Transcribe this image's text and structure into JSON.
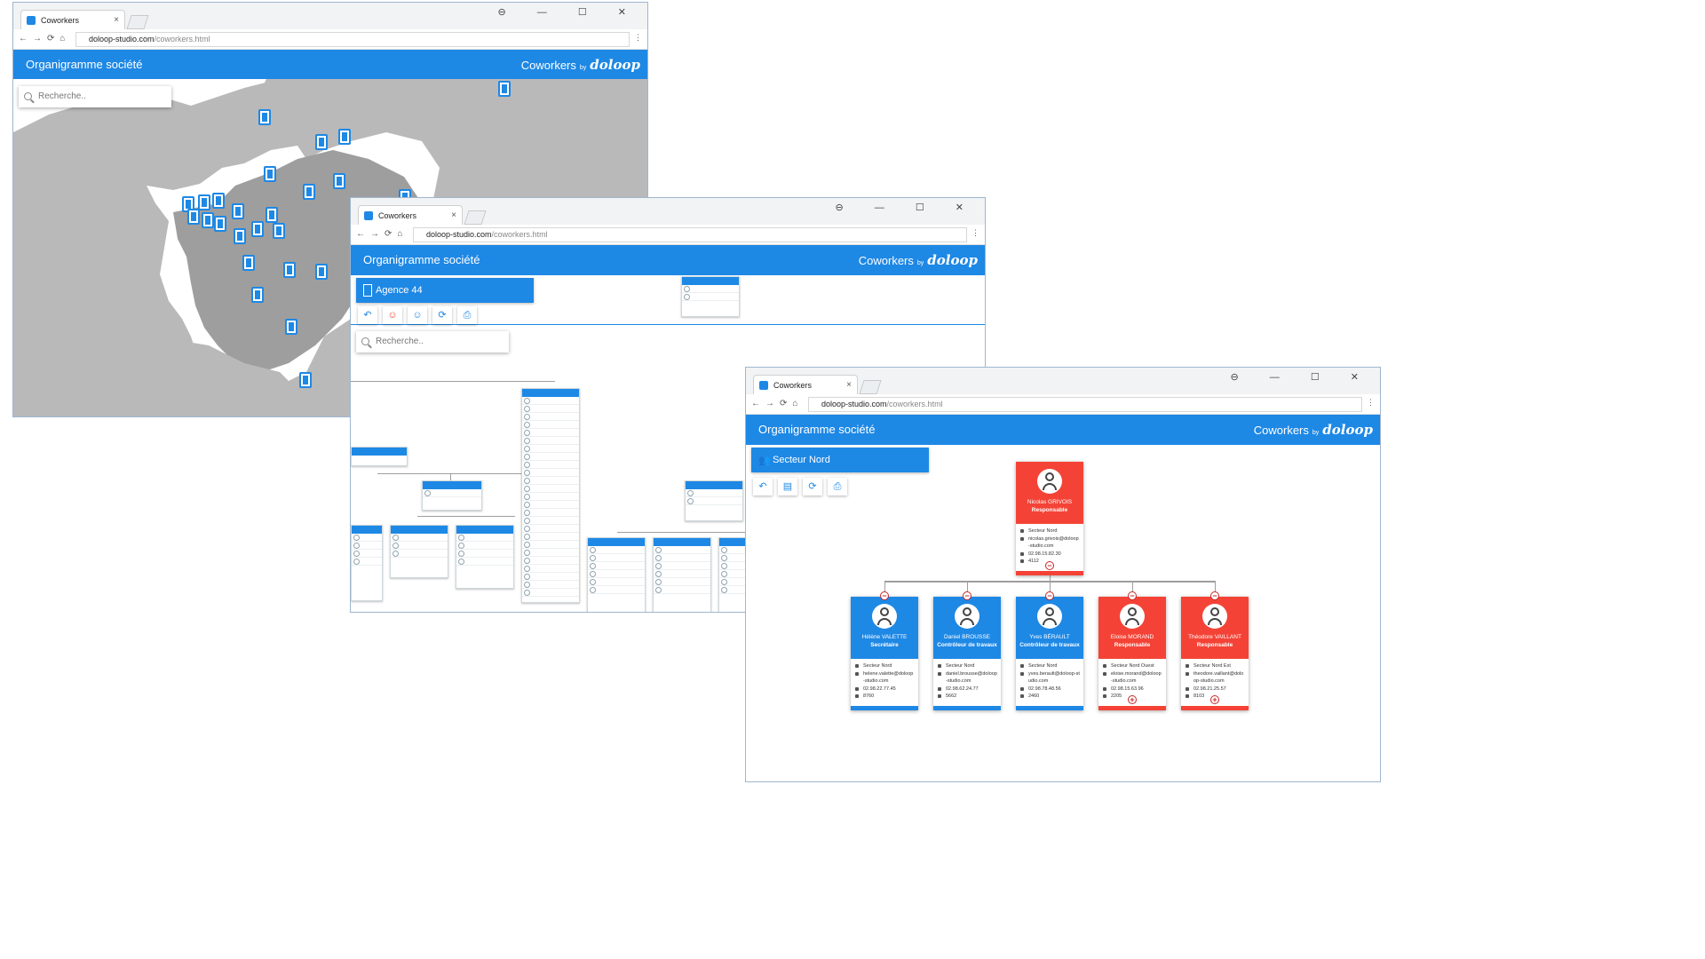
{
  "browser": {
    "tab_title": "Coworkers",
    "url_host": "doloop-studio.com",
    "url_path": "/coworkers.html",
    "window_controls": "⊖ — ☐ ✕"
  },
  "app": {
    "title": "Organigramme société",
    "brand": "Coworkers",
    "by": "by",
    "logo": "doloop",
    "accent_color": "#1e88e5",
    "alert_color": "#f44336"
  },
  "window1": {
    "search_placeholder": "Recherche.."
  },
  "window2": {
    "header": "Agence 44",
    "search_placeholder": "Recherche..",
    "tool_icons": [
      "back-icon",
      "user-red-icon",
      "user-icon",
      "refresh-icon",
      "print-icon"
    ]
  },
  "window3": {
    "header": "Secteur Nord",
    "tool_icons": [
      "back-icon",
      "id-card-icon",
      "refresh-icon",
      "print-icon"
    ],
    "root": {
      "name": "Nicolas GRIVOIS",
      "role": "Responsable",
      "sector": "Secteur Nord",
      "email": "nicolas.grivois@doloop-studio.com",
      "phone": "02.98.15.82.30",
      "ext": "4112"
    },
    "children": [
      {
        "name": "Hélène VALETTE",
        "role": "Secrétaire",
        "sector": "Secteur Nord",
        "email": "helene.valette@doloop-studio.com",
        "phone": "02.98.22.77.45",
        "ext": "8760",
        "red": false
      },
      {
        "name": "Daniel BROUSSE",
        "role": "Contrôleur de travaux",
        "sector": "Secteur Nord",
        "email": "daniel.brousse@doloop-studio.com",
        "phone": "02.98.62.24.77",
        "ext": "5662",
        "red": false
      },
      {
        "name": "Yves BÉRAULT",
        "role": "Contrôleur de travaux",
        "sector": "Secteur Nord",
        "email": "yves.berault@doloop-studio.com",
        "phone": "02.98.78.48.56",
        "ext": "2460",
        "red": false
      },
      {
        "name": "Eloise MORAND",
        "role": "Responsable",
        "sector": "Secteur Nord Ouest",
        "email": "eloise.morand@doloop-studio.com",
        "phone": "02.98.15.63.96",
        "ext": "2205",
        "red": true
      },
      {
        "name": "Théodore VAILLANT",
        "role": "Responsable",
        "sector": "Secteur Nord Est",
        "email": "theodore.vaillant@doloop-studio.com",
        "phone": "02.98.21.25.57",
        "ext": "8103",
        "red": true
      }
    ]
  }
}
